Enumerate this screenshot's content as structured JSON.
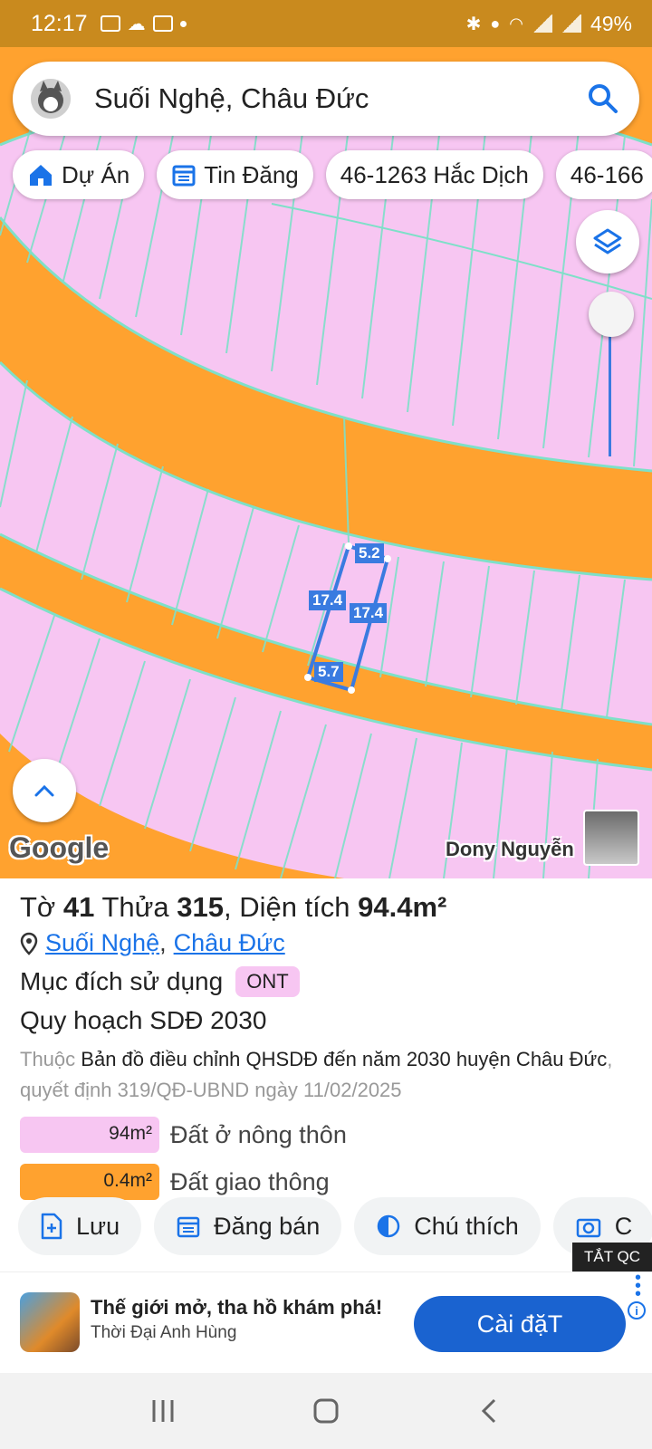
{
  "status_bar": {
    "time": "12:17",
    "battery": "49%"
  },
  "search": {
    "query": "Suối Nghệ, Châu Đức"
  },
  "chips": [
    {
      "label": "Dự Án",
      "icon": "home-icon"
    },
    {
      "label": "Tin Đăng",
      "icon": "calendar-icon"
    },
    {
      "label": "46-1263 Hắc Dịch"
    },
    {
      "label": "46-166"
    }
  ],
  "map": {
    "attribution": "Google",
    "owner_name": "Dony Nguyễn",
    "measurements": {
      "top": "5.2",
      "left": "17.4",
      "right": "17.4",
      "bottom": "5.7"
    },
    "colors": {
      "residential": "#f7c6f2",
      "road": "#ffa22f",
      "lines": "#7ee0c8",
      "parcel": "#3a7be0"
    }
  },
  "parcel": {
    "to_label": "Tờ",
    "to_value": "41",
    "thua_label": "Thửa",
    "thua_value": "315",
    "area_label": ", Diện tích",
    "area_value": "94.4m²",
    "location": {
      "commune": "Suối Nghệ",
      "sep": ",",
      "district": "Châu Đức"
    },
    "purpose_label": "Mục đích sử dụng",
    "purpose_code": "ONT",
    "plan_title": "Quy hoạch SDĐ 2030",
    "plan_prefix": "Thuộc",
    "plan_doc": "Bản đồ điều chỉnh QHSDĐ đến năm 2030 huyện Châu Đức",
    "plan_decision": ", quyết định 319/QĐ-UBND ngày 11/02/2025",
    "legend": [
      {
        "area": "94m²",
        "label": "Đất ở nông thôn",
        "color": "#f7c6f2"
      },
      {
        "area": "0.4m²",
        "label": "Đất giao thông",
        "color": "#ffa22f"
      }
    ]
  },
  "actions": [
    {
      "label": "Lưu",
      "icon": "save-icon"
    },
    {
      "label": "Đăng bán",
      "icon": "calendar-icon"
    },
    {
      "label": "Chú thích",
      "icon": "contrast-icon"
    },
    {
      "label": "C",
      "icon": "camera-icon"
    }
  ],
  "ad": {
    "hide_label": "TẮT QC",
    "title": "Thế giới mở, tha hồ khám phá!",
    "subtitle": "Thời Đại Anh Hùng",
    "button": "Cài đặT",
    "info": "i"
  }
}
